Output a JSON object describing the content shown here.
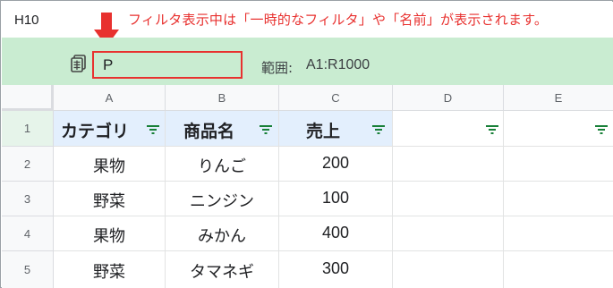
{
  "name_box": {
    "cell_ref": "H10"
  },
  "annotation": {
    "text": "フィルタ表示中は「一時的なフィルタ」や「名前」が表示されます。",
    "color": "#e8312f"
  },
  "filter_bar": {
    "filter_name": "P",
    "range_label": "範囲:",
    "range_value": "A1:R1000",
    "background": "#c9ecd1"
  },
  "columns": [
    "A",
    "B",
    "C",
    "D",
    "E"
  ],
  "rows": [
    "1",
    "2",
    "3",
    "4",
    "5"
  ],
  "table": {
    "headers": [
      "カテゴリ",
      "商品名",
      "売上",
      "",
      ""
    ],
    "data": [
      [
        "果物",
        "りんご",
        "200"
      ],
      [
        "野菜",
        "ニンジン",
        "100"
      ],
      [
        "果物",
        "みかん",
        "400"
      ],
      [
        "野菜",
        "タマネギ",
        "300"
      ]
    ]
  },
  "icons": {
    "filter_view_icon": "filter-view-icon",
    "filter_button_icon": "funnel-icon",
    "arrow": "down-arrow-icon"
  },
  "colors": {
    "header_fill": "#e3effd",
    "filter_icon": "#188038",
    "arrow": "#e8312f"
  }
}
